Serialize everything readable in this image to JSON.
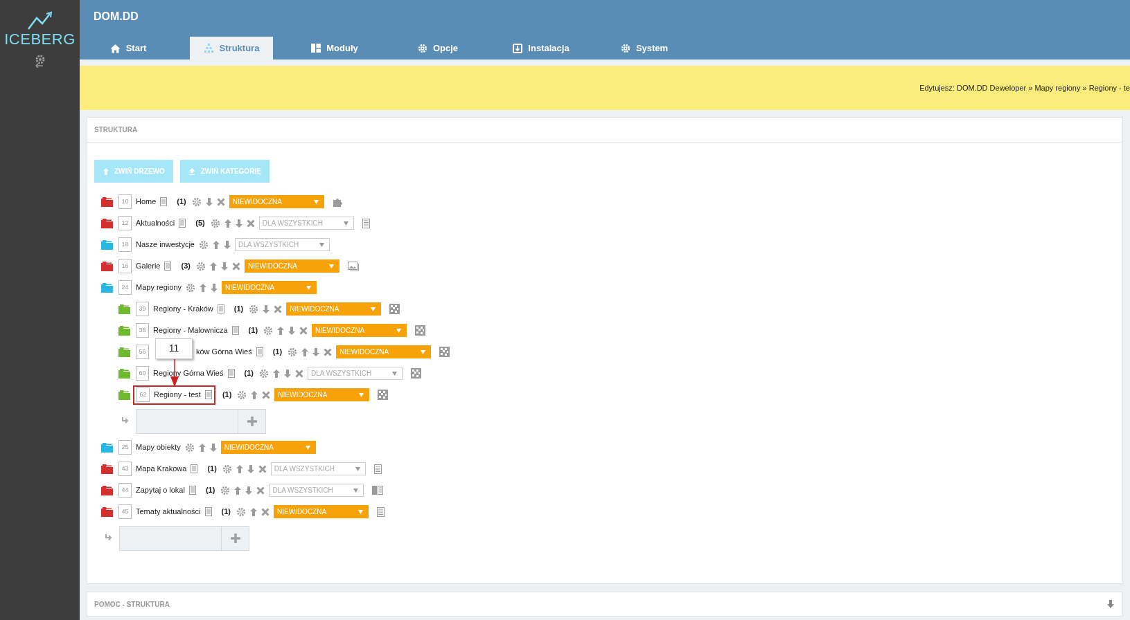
{
  "sidebar": {
    "logo": "ICEBERG"
  },
  "header": {
    "title": "DOM.DD"
  },
  "tabs": [
    {
      "label": "Start",
      "kind": "home",
      "selected": false
    },
    {
      "label": "Struktura",
      "kind": "tree",
      "selected": true
    },
    {
      "label": "Moduły",
      "kind": "modules",
      "selected": false
    },
    {
      "label": "Opcje",
      "kind": "gear",
      "selected": false
    },
    {
      "label": "Instalacja",
      "kind": "install",
      "selected": false
    },
    {
      "label": "System",
      "kind": "gear",
      "selected": false
    }
  ],
  "breadcrumb": "Edytujesz: DOM.DD Deweloper » Mapy regiony » Regiony - te",
  "panel": {
    "title": "STRUKTURA",
    "buttons": [
      {
        "label": "ZWIŃ DRZEWO",
        "kind": "collapse-tree"
      },
      {
        "label": "ZWIŃ KATEGORIĘ",
        "kind": "collapse-category"
      }
    ]
  },
  "tree": [
    {
      "id": "10",
      "name": "Home",
      "color": "#d32f2f",
      "page": true,
      "count": "(1)",
      "up": false,
      "down": true,
      "delete": true,
      "visibility": {
        "text": "NIEWIDOCZNA",
        "kind": "hidden"
      },
      "trailing_icon": {
        "kind": "puzzle"
      }
    },
    {
      "id": "12",
      "name": "Aktualności",
      "color": "#d32f2f",
      "page": true,
      "count": "(5)",
      "up": true,
      "down": true,
      "delete": true,
      "visibility": {
        "text": "DLA WSZYSTKICH",
        "kind": "public"
      },
      "trailing_icon": {
        "kind": "page"
      }
    },
    {
      "id": "18",
      "name": "Nasze inwestycje",
      "color": "#29b6e3",
      "page": false,
      "up": true,
      "down": true,
      "delete": false,
      "visibility": {
        "text": "DLA WSZYSTKICH",
        "kind": "public"
      }
    },
    {
      "id": "16",
      "name": "Galerie",
      "color": "#d32f2f",
      "page": true,
      "count": "(3)",
      "up": true,
      "down": true,
      "delete": true,
      "visibility": {
        "text": "NIEWIDOCZNA",
        "kind": "hidden"
      },
      "trailing_icon": {
        "kind": "gallery"
      }
    },
    {
      "id": "24",
      "name": "Mapy regiony",
      "color": "#29b6e3",
      "page": false,
      "up": true,
      "down": true,
      "delete": false,
      "visibility": {
        "text": "NIEWIDOCZNA",
        "kind": "hidden"
      },
      "add_row": true,
      "children": [
        {
          "id": "39",
          "name": "Regiony - Kraków",
          "color": "#6dbb2c",
          "page": true,
          "count": "(1)",
          "up": false,
          "down": true,
          "delete": true,
          "visibility": {
            "text": "NIEWIDOCZNA",
            "kind": "hidden"
          },
          "trailing_icon": {
            "kind": "map"
          }
        },
        {
          "id": "38",
          "name": "Regiony - Malownicza",
          "color": "#6dbb2c",
          "page": true,
          "count": "(1)",
          "up": true,
          "down": true,
          "delete": true,
          "visibility": {
            "text": "NIEWIDOCZNA",
            "kind": "hidden"
          },
          "trailing_icon": {
            "kind": "map"
          }
        },
        {
          "id": "56",
          "name": "ków Górna Wieś",
          "covered": true,
          "color": "#6dbb2c",
          "page": true,
          "count": "(1)",
          "up": true,
          "down": true,
          "delete": true,
          "visibility": {
            "text": "NIEWIDOCZNA",
            "kind": "hidden"
          },
          "trailing_icon": {
            "kind": "map"
          }
        },
        {
          "id": "60",
          "name": "Regiony Górna Wieś",
          "color": "#6dbb2c",
          "page": true,
          "count": "(1)",
          "up": true,
          "down": true,
          "delete": true,
          "visibility": {
            "text": "DLA WSZYSTKICH",
            "kind": "public"
          },
          "trailing_icon": {
            "kind": "map"
          }
        },
        {
          "id": "62",
          "name": "Regiony - test",
          "color": "#6dbb2c",
          "page": true,
          "count": "(1)",
          "up": true,
          "down": false,
          "delete": true,
          "visibility": {
            "text": "NIEWIDOCZNA",
            "kind": "hidden"
          },
          "trailing_icon": {
            "kind": "map"
          },
          "annotation": "11"
        }
      ]
    },
    {
      "id": "25",
      "name": "Mapy obiekty",
      "color": "#29b6e3",
      "page": false,
      "up": true,
      "down": true,
      "delete": false,
      "visibility": {
        "text": "NIEWIDOCZNA",
        "kind": "hidden"
      }
    },
    {
      "id": "43",
      "name": "Mapa Krakowa",
      "color": "#d32f2f",
      "page": true,
      "count": "(1)",
      "up": true,
      "down": true,
      "delete": true,
      "visibility": {
        "text": "DLA WSZYSTKICH",
        "kind": "public"
      },
      "trailing_icon": {
        "kind": "page"
      }
    },
    {
      "id": "44",
      "name": "Zapytaj o lokal",
      "color": "#d32f2f",
      "page": true,
      "count": "(1)",
      "up": true,
      "down": true,
      "delete": true,
      "visibility": {
        "text": "DLA WSZYSTKICH",
        "kind": "public"
      },
      "trailing_icon": {
        "kind": "columns"
      }
    },
    {
      "id": "45",
      "name": "Tematy aktualności",
      "color": "#d32f2f",
      "page": true,
      "count": "(1)",
      "up": true,
      "down": false,
      "delete": true,
      "visibility": {
        "text": "NIEWIDOCZNA",
        "kind": "hidden"
      },
      "trailing_icon": {
        "kind": "page"
      }
    }
  ],
  "tree_add_row": true,
  "help_panel": {
    "title": "POMOC - STRUKTURA"
  }
}
